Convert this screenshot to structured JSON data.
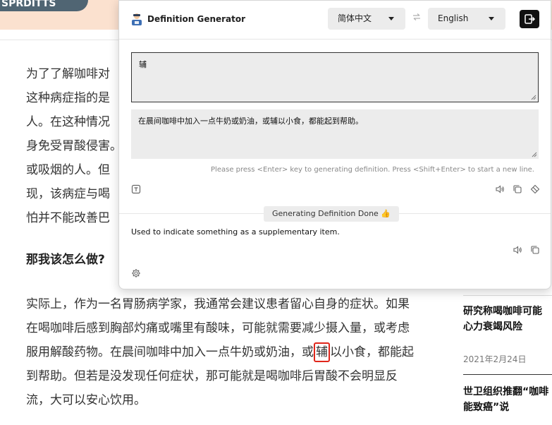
{
  "article": {
    "banner_text": "SPRDITTS",
    "lines": [
      "为了了解咖啡对",
      "这种病症指的是",
      "人。在这种情况",
      "身免受胃酸侵害。",
      "或吸烟的人。但",
      "现，该病症与喝",
      "怕并不能改善巴"
    ],
    "heading": "那我该怎么做?",
    "para": [
      "实际上，作为一名胃肠病学家，我通常会建议患者留心自身的症状。如果",
      "在喝咖啡后感到胸部灼痛或嘴里有酸味，可能就需要减少摄入量，或考虑"
    ],
    "line3_before": "服用解酸药物。在晨间咖啡中加入一点牛奶或奶油，或",
    "line3_highlight": "辅",
    "line3_after": "以小食，都能起",
    "para_end": [
      "到帮助。但若是没发现任何症状，那可能就是喝咖啡后胃酸不会明显反",
      "流，大可以安心饮用。"
    ]
  },
  "sidebar": {
    "story1_title": [
      "研究称喝咖啡可能",
      "心力衰竭风险"
    ],
    "story1_date": "2021年2月24日",
    "story2_title": [
      "世卫组织推翻“咖啡",
      "能致癌”说"
    ]
  },
  "popup": {
    "title": "Definition Generator",
    "source_lang": "简体中文",
    "target_lang": "English",
    "word": "辅",
    "sentence": "在晨间咖啡中加入一点牛奶或奶油，或辅以小食，都能起到帮助。",
    "hint": "Please press <Enter> key to generating definition. Press <Shift+Enter> to start a new line.",
    "status": "Generating Definition Done 👍",
    "definition": "Used to indicate something as a supplementary item."
  },
  "icons": [
    "app-logo-icon",
    "swap-icon",
    "exit-icon",
    "text-format-icon",
    "speaker-icon",
    "copy-icon",
    "eraser-icon",
    "settings-icon"
  ],
  "colors": {
    "highlight": "#e0261b",
    "panel_bg": "#ececec",
    "banner_bg": "#fbe1cf"
  }
}
